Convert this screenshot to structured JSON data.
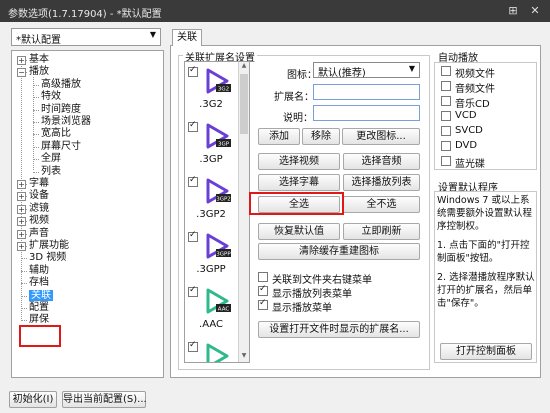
{
  "window": {
    "title": "参数选项(1.7.17904) - *默认配置",
    "pin_icon": "pin-icon",
    "close_icon": "close-icon"
  },
  "preset": {
    "value": "*默认配置"
  },
  "tree": [
    {
      "label": "基本",
      "level": 0,
      "toggle": "+"
    },
    {
      "label": "播放",
      "level": 0,
      "toggle": "-"
    },
    {
      "label": "高级播放",
      "level": 1
    },
    {
      "label": "特效",
      "level": 1
    },
    {
      "label": "时间跨度",
      "level": 1
    },
    {
      "label": "场景浏览器",
      "level": 1
    },
    {
      "label": "宽高比",
      "level": 1
    },
    {
      "label": "屏幕尺寸",
      "level": 1
    },
    {
      "label": "全屏",
      "level": 1
    },
    {
      "label": "列表",
      "level": 1
    },
    {
      "label": "字幕",
      "level": 0,
      "toggle": "+"
    },
    {
      "label": "设备",
      "level": 0,
      "toggle": "+"
    },
    {
      "label": "滤镜",
      "level": 0,
      "toggle": "+"
    },
    {
      "label": "视频",
      "level": 0,
      "toggle": "+"
    },
    {
      "label": "声音",
      "level": 0,
      "toggle": "+"
    },
    {
      "label": "扩展功能",
      "level": 0,
      "toggle": "+"
    },
    {
      "label": "3D 视频",
      "level": 0
    },
    {
      "label": "辅助",
      "level": 0
    },
    {
      "label": "存档",
      "level": 0
    },
    {
      "label": "关联",
      "level": 0,
      "selected": true
    },
    {
      "label": "配置",
      "level": 0
    },
    {
      "label": "屏保",
      "level": 0
    }
  ],
  "tab": {
    "label": "关联"
  },
  "assoc": {
    "group_title": "关联扩展名设置",
    "files": [
      {
        "badge": "3G2",
        "ext": ".3G2",
        "checked": true,
        "color": "#6a3fd6"
      },
      {
        "badge": "3GP",
        "ext": ".3GP",
        "checked": true,
        "color": "#6a3fd6"
      },
      {
        "badge": "3GP2",
        "ext": ".3GP2",
        "checked": true,
        "color": "#6a3fd6"
      },
      {
        "badge": "3GPP",
        "ext": ".3GPP",
        "checked": true,
        "color": "#6a3fd6"
      },
      {
        "badge": "AAC",
        "ext": ".AAC",
        "checked": true,
        "color": "#2fb88a"
      },
      {
        "badge": "",
        "ext": "",
        "checked": true,
        "color": "#2fb88a"
      }
    ],
    "icon_label": "图标：",
    "icon_value": "默认(推荐)",
    "extname_label": "扩展名：",
    "desc_label": "说明：",
    "add": "添加",
    "remove": "移除",
    "change_icon": "更改图标...",
    "select_video": "选择视频",
    "select_audio": "选择音频",
    "select_sub": "选择字幕",
    "select_playlist": "选择播放列表",
    "select_all": "全选",
    "select_none": "全不选",
    "restore_default": "恢复默认值",
    "refresh_now": "立即刷新",
    "clear_cache": "清除缓存重建图标",
    "ctx_folder": "关联到文件夹右键菜单",
    "ctx_playlist": "显示播放列表菜单",
    "ctx_play": "显示播放菜单",
    "ctx_folder_checked": false,
    "ctx_playlist_checked": true,
    "ctx_play_checked": true,
    "open_ext_btn": "设置打开文件时显示的扩展名..."
  },
  "autoplay": {
    "title": "自动播放",
    "items": [
      {
        "label": "视频文件",
        "checked": false
      },
      {
        "label": "音频文件",
        "checked": false
      },
      {
        "label": "音乐CD",
        "checked": false
      },
      {
        "label": "VCD",
        "checked": false
      },
      {
        "label": "SVCD",
        "checked": false
      },
      {
        "label": "DVD",
        "checked": false
      },
      {
        "label": "蓝光碟",
        "checked": false
      }
    ]
  },
  "default_prog": {
    "title": "设置默认程序",
    "text1": "Windows 7 或以上系统需要额外设置默认程序控制权。",
    "text2": "1. 点击下面的\"打开控制面板\"按钮。",
    "text3": "2. 选择潜播放程序默认打开的扩展名，然后单击\"保存\"。",
    "button": "打开控制面板"
  },
  "bottom": {
    "init": "初始化(I)",
    "export": "导出当前配置(S)..."
  }
}
